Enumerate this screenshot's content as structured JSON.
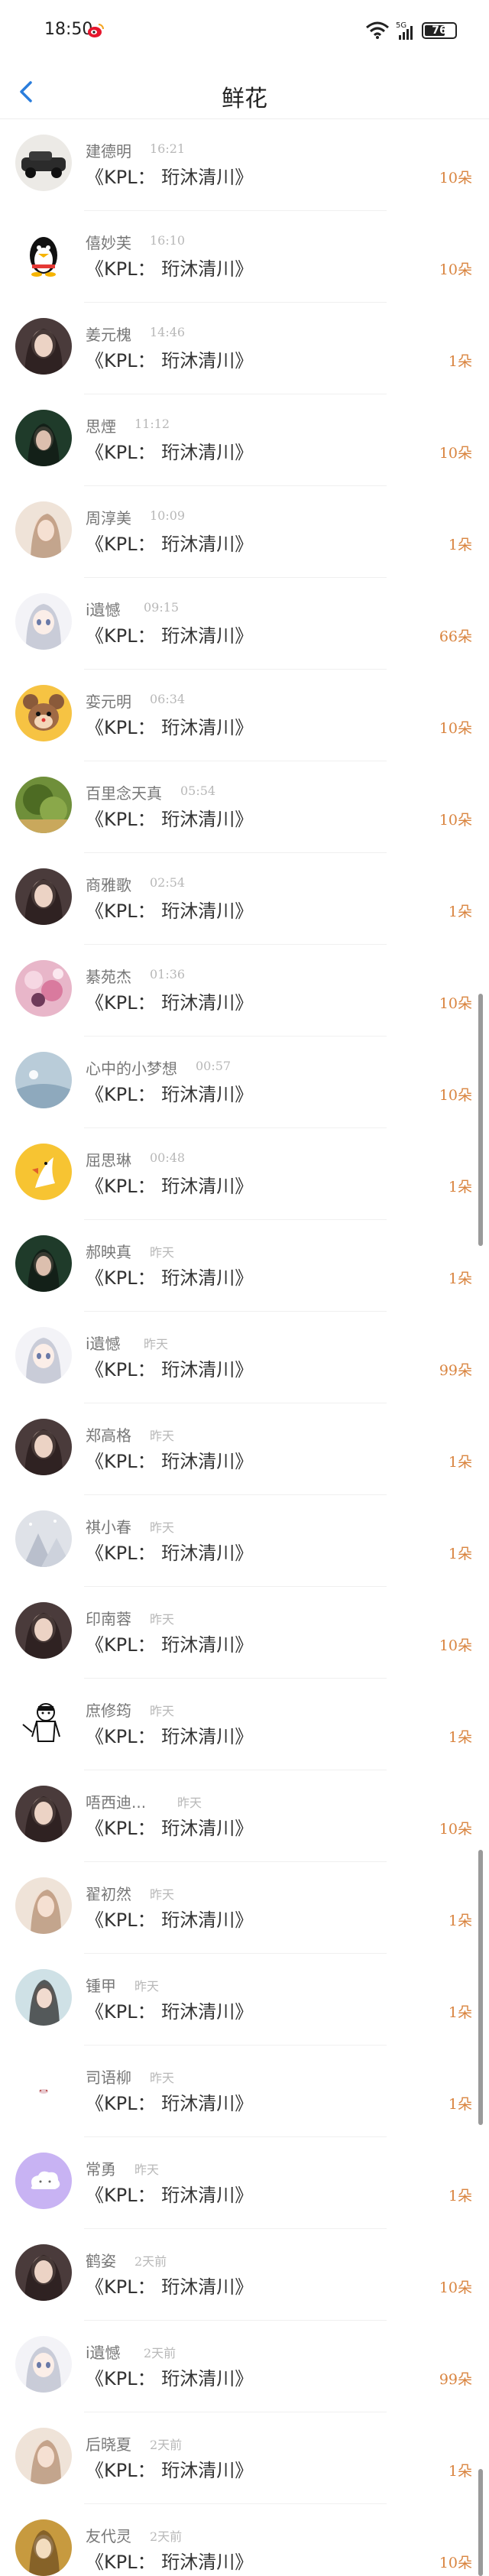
{
  "status_bar": {
    "time": "18:50",
    "battery": "76",
    "signal": "5G"
  },
  "header": {
    "title": "鲜花"
  },
  "gift_text": "《KPL： 珩沐清川》",
  "rows": [
    {
      "name": "建德明",
      "time": "16:21",
      "count": "10朵"
    },
    {
      "name": "僖妙芙",
      "time": "16:10",
      "count": "10朵"
    },
    {
      "name": "姜元槐",
      "time": "14:46",
      "count": "1朵"
    },
    {
      "name": "思煙",
      "time": "11:12",
      "count": "10朵"
    },
    {
      "name": "周淳美",
      "time": "10:09",
      "count": "1朵"
    },
    {
      "name": "i遺憾",
      "time": "09:15",
      "count": "66朵"
    },
    {
      "name": "娈元明",
      "time": "06:34",
      "count": "10朵"
    },
    {
      "name": "百里念天真",
      "time": "05:54",
      "count": "10朵"
    },
    {
      "name": "商雅歌",
      "time": "02:54",
      "count": "1朵"
    },
    {
      "name": "綦苑杰",
      "time": "01:36",
      "count": "10朵"
    },
    {
      "name": "心中的小梦想",
      "time": "00:57",
      "count": "10朵"
    },
    {
      "name": "屈思琳",
      "time": "00:48",
      "count": "1朵"
    },
    {
      "name": "郝映真",
      "time": "昨天",
      "count": "1朵"
    },
    {
      "name": "i遺憾",
      "time": "昨天",
      "count": "99朵"
    },
    {
      "name": "郑高格",
      "time": "昨天",
      "count": "1朵"
    },
    {
      "name": "祺小春",
      "time": "昨天",
      "count": "1朵"
    },
    {
      "name": "印南蓉",
      "time": "昨天",
      "count": "10朵"
    },
    {
      "name": "庶修筠",
      "time": "昨天",
      "count": "1朵"
    },
    {
      "name": "唔西迪...",
      "time": "昨天",
      "count": "10朵"
    },
    {
      "name": "翟初然",
      "time": "昨天",
      "count": "1朵"
    },
    {
      "name": "锺甲",
      "time": "昨天",
      "count": "1朵"
    },
    {
      "name": "司语柳",
      "time": "昨天",
      "count": "1朵"
    },
    {
      "name": "常勇",
      "time": "昨天",
      "count": "1朵"
    },
    {
      "name": "鹤姿",
      "time": "2天前",
      "count": "10朵"
    },
    {
      "name": "i遺憾",
      "time": "2天前",
      "count": "99朵"
    },
    {
      "name": "后晓夏",
      "time": "2天前",
      "count": "1朵"
    },
    {
      "name": "友代灵",
      "time": "2天前",
      "count": "10朵"
    }
  ],
  "avatar_styles": [
    "car",
    "penguin",
    "girl-dark",
    "girl-green",
    "girl-light",
    "anime-girl",
    "cartoon-mouse",
    "nature",
    "girl-dark",
    "flowers",
    "sky",
    "yellow-bird",
    "girl-green",
    "anime-girl",
    "girl-dark",
    "snow",
    "girl-dark",
    "sketch",
    "girl-dark",
    "girl-light",
    "girl-teal",
    "white",
    "purple-cloud",
    "girl-dark",
    "anime-girl",
    "girl-light",
    "girl-gold"
  ],
  "colors": {
    "count": "#d9843f",
    "time": "#b8b8b8",
    "name": "#777777",
    "back": "#2a7ddc"
  }
}
